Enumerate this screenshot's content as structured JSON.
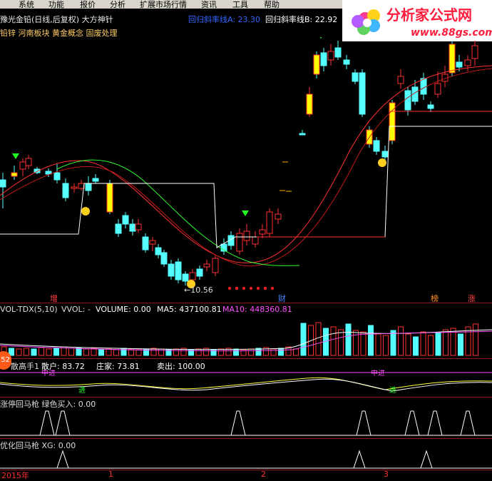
{
  "menu": [
    "系统",
    "功能",
    "报价",
    "分析",
    "扩展市场行情",
    "资讯",
    "工具",
    "帮助"
  ],
  "watermark": {
    "title": "分析家公式网",
    "url": "www.88gs.com"
  },
  "header": {
    "title": "豫光金铅(日线,后复权) 大方神针",
    "lineA": "回归斜率线A: 23.30",
    "lineB": "回归斜率线B: 22.92",
    "concepts": "铅锌 河南板块 黄金概念 固废处理"
  },
  "main_chart": {
    "low_label": "←10.56",
    "bottom_labels": [
      {
        "text": "增",
        "color": "#ff4040"
      },
      {
        "text": "财",
        "color": "#4080ff"
      },
      {
        "text": "榜",
        "color": "#ff9020"
      },
      {
        "text": "涨",
        "color": "#ff4040"
      }
    ]
  },
  "vol_panel": {
    "name": "VOL-TDX(5,10)",
    "vvol": "VVOL: -",
    "volume": "VOLUME: 0.00",
    "ma5": "MA5: 437100.81",
    "ma10": "MA10: 448360.81"
  },
  "indicator_panel": {
    "badge": "52",
    "name": "散高手1",
    "retail": "散户: 83.72",
    "dealer": "庄家: 73.81",
    "sell": "卖出: 100.00",
    "marks": [
      "进",
      "进",
      "中进",
      "中进"
    ]
  },
  "panel3": {
    "label": "涨停回马枪  绿色买入: 0.00"
  },
  "panel4": {
    "label": "优化回马枪  XG: 0.00"
  },
  "time_axis": {
    "labels": [
      "2015年",
      "1",
      "2",
      "3"
    ]
  },
  "colors": {
    "up": "#ff3030",
    "down": "#54ffff",
    "bg": "#000000",
    "yellow": "#ffff00",
    "magenta": "#ff50ff",
    "green": "#00ff00"
  }
}
